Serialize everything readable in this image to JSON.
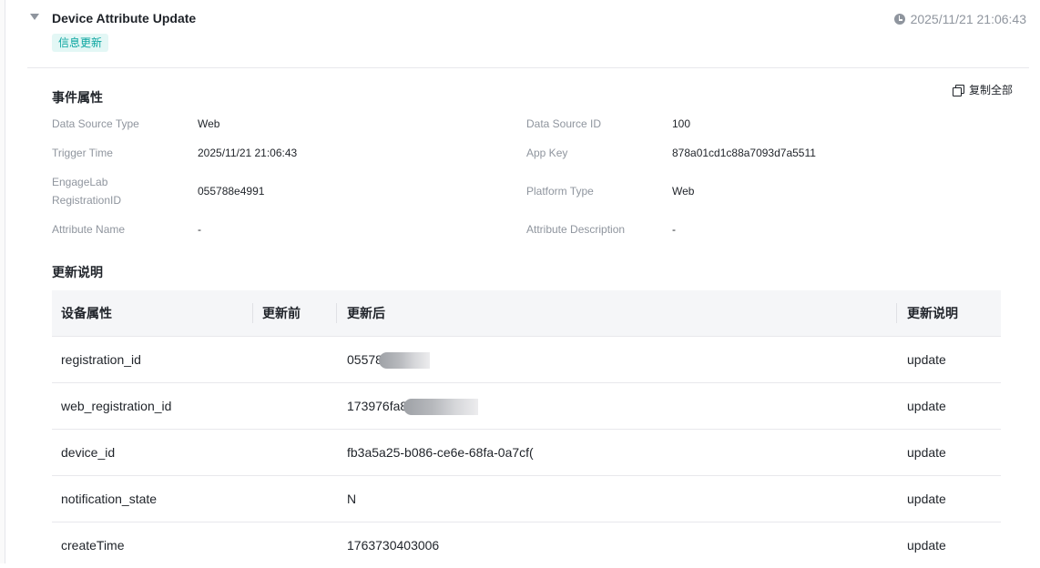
{
  "header": {
    "title": "Device Attribute Update",
    "tag": "信息更新",
    "timestamp": "2025/11/21 21:06:43"
  },
  "event_props": {
    "title": "事件属性",
    "copy_all": "复制全部",
    "left": [
      {
        "label": "Data Source Type",
        "value": "Web"
      },
      {
        "label": "Trigger Time",
        "value": "2025/11/21 21:06:43"
      },
      {
        "label": "EngageLab RegistrationID",
        "value": "055788e4991"
      },
      {
        "label": "Attribute Name",
        "value": "-"
      }
    ],
    "right": [
      {
        "label": "Data Source ID",
        "value": "100"
      },
      {
        "label": "App Key",
        "value": "878a01cd1c88a7093d7a5511"
      },
      {
        "label": "Platform Type",
        "value": "Web"
      },
      {
        "label": "Attribute Description",
        "value": "-"
      }
    ]
  },
  "update_desc": {
    "title": "更新说明",
    "columns": [
      "设备属性",
      "更新前",
      "更新后",
      "更新说明"
    ],
    "rows": [
      {
        "attr": "registration_id",
        "before": "",
        "after": "05578",
        "note": "update"
      },
      {
        "attr": "web_registration_id",
        "before": "",
        "after": "173976fa8",
        "note": "update"
      },
      {
        "attr": "device_id",
        "before": "",
        "after": "fb3a5a25-b086-ce6e-68fa-0a7cf(",
        "note": "update"
      },
      {
        "attr": "notification_state",
        "before": "",
        "after": "N",
        "note": "update"
      },
      {
        "attr": "createTime",
        "before": "",
        "after": "1763730403006",
        "note": "update"
      }
    ]
  }
}
